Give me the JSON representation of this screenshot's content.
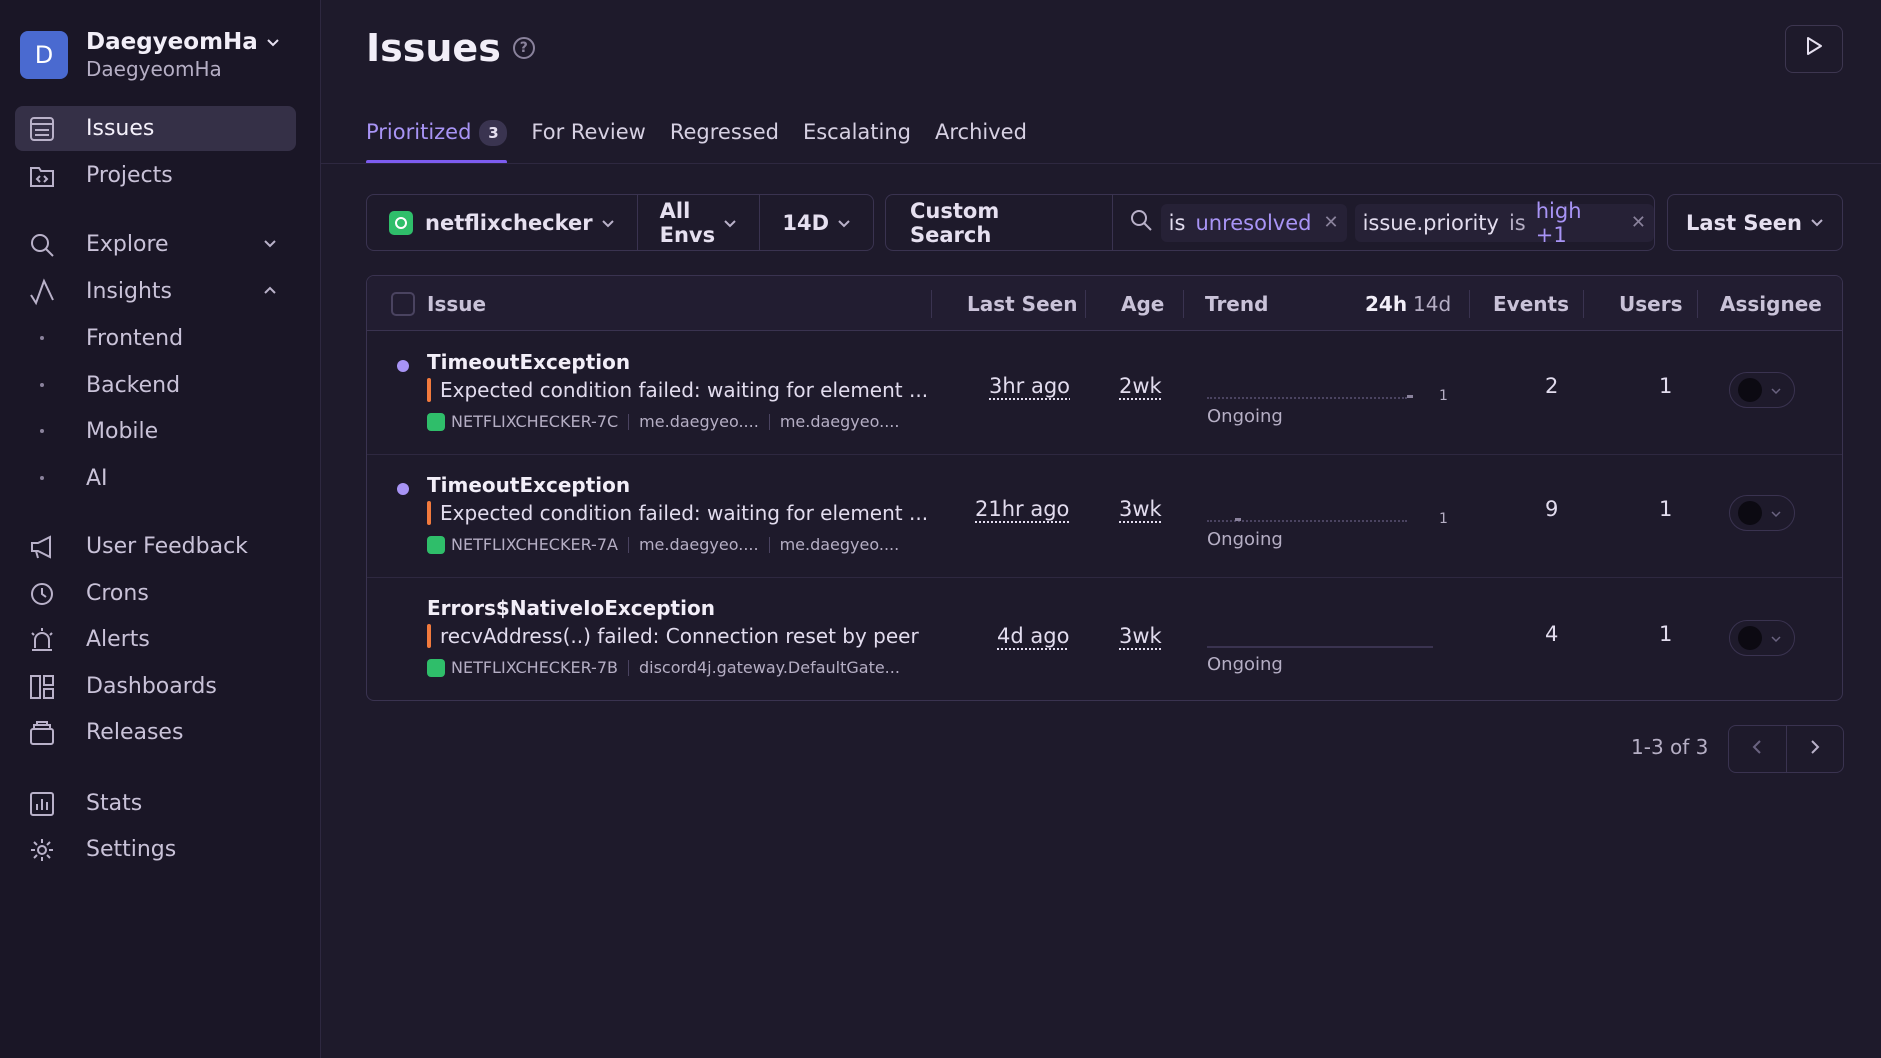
{
  "org": {
    "initial": "D",
    "name": "DaegyeomHa",
    "sub": "DaegyeomHa"
  },
  "nav": {
    "issues": "Issues",
    "projects": "Projects",
    "explore": "Explore",
    "insights": "Insights",
    "insights_sub": [
      "Frontend",
      "Backend",
      "Mobile",
      "AI"
    ],
    "user_feedback": "User Feedback",
    "crons": "Crons",
    "alerts": "Alerts",
    "dashboards": "Dashboards",
    "releases": "Releases",
    "stats": "Stats",
    "settings": "Settings"
  },
  "page": {
    "title": "Issues",
    "help": "?"
  },
  "tabs": [
    {
      "label": "Prioritized",
      "count": "3",
      "active": true
    },
    {
      "label": "For Review"
    },
    {
      "label": "Regressed"
    },
    {
      "label": "Escalating"
    },
    {
      "label": "Archived"
    }
  ],
  "filters": {
    "project": "netflixchecker",
    "envs": "All Envs",
    "period": "14D",
    "custom_search": "Custom Search",
    "token1": {
      "key": "is",
      "value": "unresolved"
    },
    "token2": {
      "key": "issue.priority",
      "op": "is",
      "value": "high +1"
    },
    "sort": "Last Seen"
  },
  "table": {
    "headers": {
      "issue": "Issue",
      "last_seen": "Last Seen",
      "age": "Age",
      "trend": "Trend",
      "range_24h": "24h",
      "range_14d": "14d",
      "events": "Events",
      "users": "Users",
      "assignee": "Assignee"
    },
    "rows": [
      {
        "title": "TimeoutException",
        "message": "Expected condition failed: waiting for element ...",
        "short_id": "NETFLIXCHECKER-7C",
        "meta1": "me.daegyeo....",
        "meta2": "me.daegyeo....",
        "last_seen": "3hr ago",
        "age": "2wk",
        "trend_max": "1",
        "trend_status": "Ongoing",
        "events": "2",
        "users": "1"
      },
      {
        "title": "TimeoutException",
        "message": "Expected condition failed: waiting for element ...",
        "short_id": "NETFLIXCHECKER-7A",
        "meta1": "me.daegyeo....",
        "meta2": "me.daegyeo....",
        "last_seen": "21hr ago",
        "age": "3wk",
        "trend_max": "1",
        "trend_status": "Ongoing",
        "events": "9",
        "users": "1"
      },
      {
        "title": "Errors$NativeIoException",
        "message": "recvAddress(..) failed: Connection reset by peer",
        "short_id": "NETFLIXCHECKER-7B",
        "meta1": "discord4j.gateway.DefaultGate...",
        "last_seen": "4d ago",
        "age": "3wk",
        "trend_status": "Ongoing",
        "events": "4",
        "users": "1"
      }
    ]
  },
  "pagination": {
    "text": "1-3 of 3"
  },
  "colors": {
    "accent": "#a894f5",
    "level_bar": "#f27a3d",
    "project": "#2fbe6a",
    "background": "#1e1a2b",
    "sidebar": "#1a1626"
  }
}
